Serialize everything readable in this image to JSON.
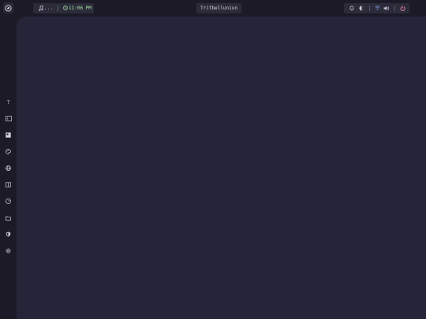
{
  "topbar": {
    "media": {
      "icon": "music-note-icon",
      "text": "..."
    },
    "clock": {
      "icon": "clock-icon",
      "time": "11:06 PM"
    },
    "workspace_title": "Tritbelluniun",
    "tray": {
      "icons": [
        "notification-icon",
        "theme-icon",
        "wifi-icon",
        "volume-icon",
        "power-icon"
      ],
      "volume_glyph": "d"
    }
  },
  "sidebar": {
    "items": [
      {
        "name": "help",
        "icon": "question-icon",
        "glyph": "?"
      },
      {
        "name": "terminal",
        "icon": "terminal-icon"
      },
      {
        "name": "editor",
        "icon": "editor-icon"
      },
      {
        "name": "palette",
        "icon": "palette-icon"
      },
      {
        "name": "browser",
        "icon": "globe-icon"
      },
      {
        "name": "reader",
        "icon": "book-icon"
      },
      {
        "name": "monitor",
        "icon": "gauge-icon"
      },
      {
        "name": "files",
        "icon": "folder-icon"
      },
      {
        "name": "security",
        "icon": "shield-icon"
      },
      {
        "name": "settings",
        "icon": "gear-icon"
      }
    ]
  },
  "colors": {
    "background": "#1b1a26",
    "panel": "#252438",
    "pill": "#2c2b3a",
    "clock_accent": "#a6e3a1",
    "wifi_accent": "#89b4fa",
    "power_accent": "#f38ba8"
  }
}
